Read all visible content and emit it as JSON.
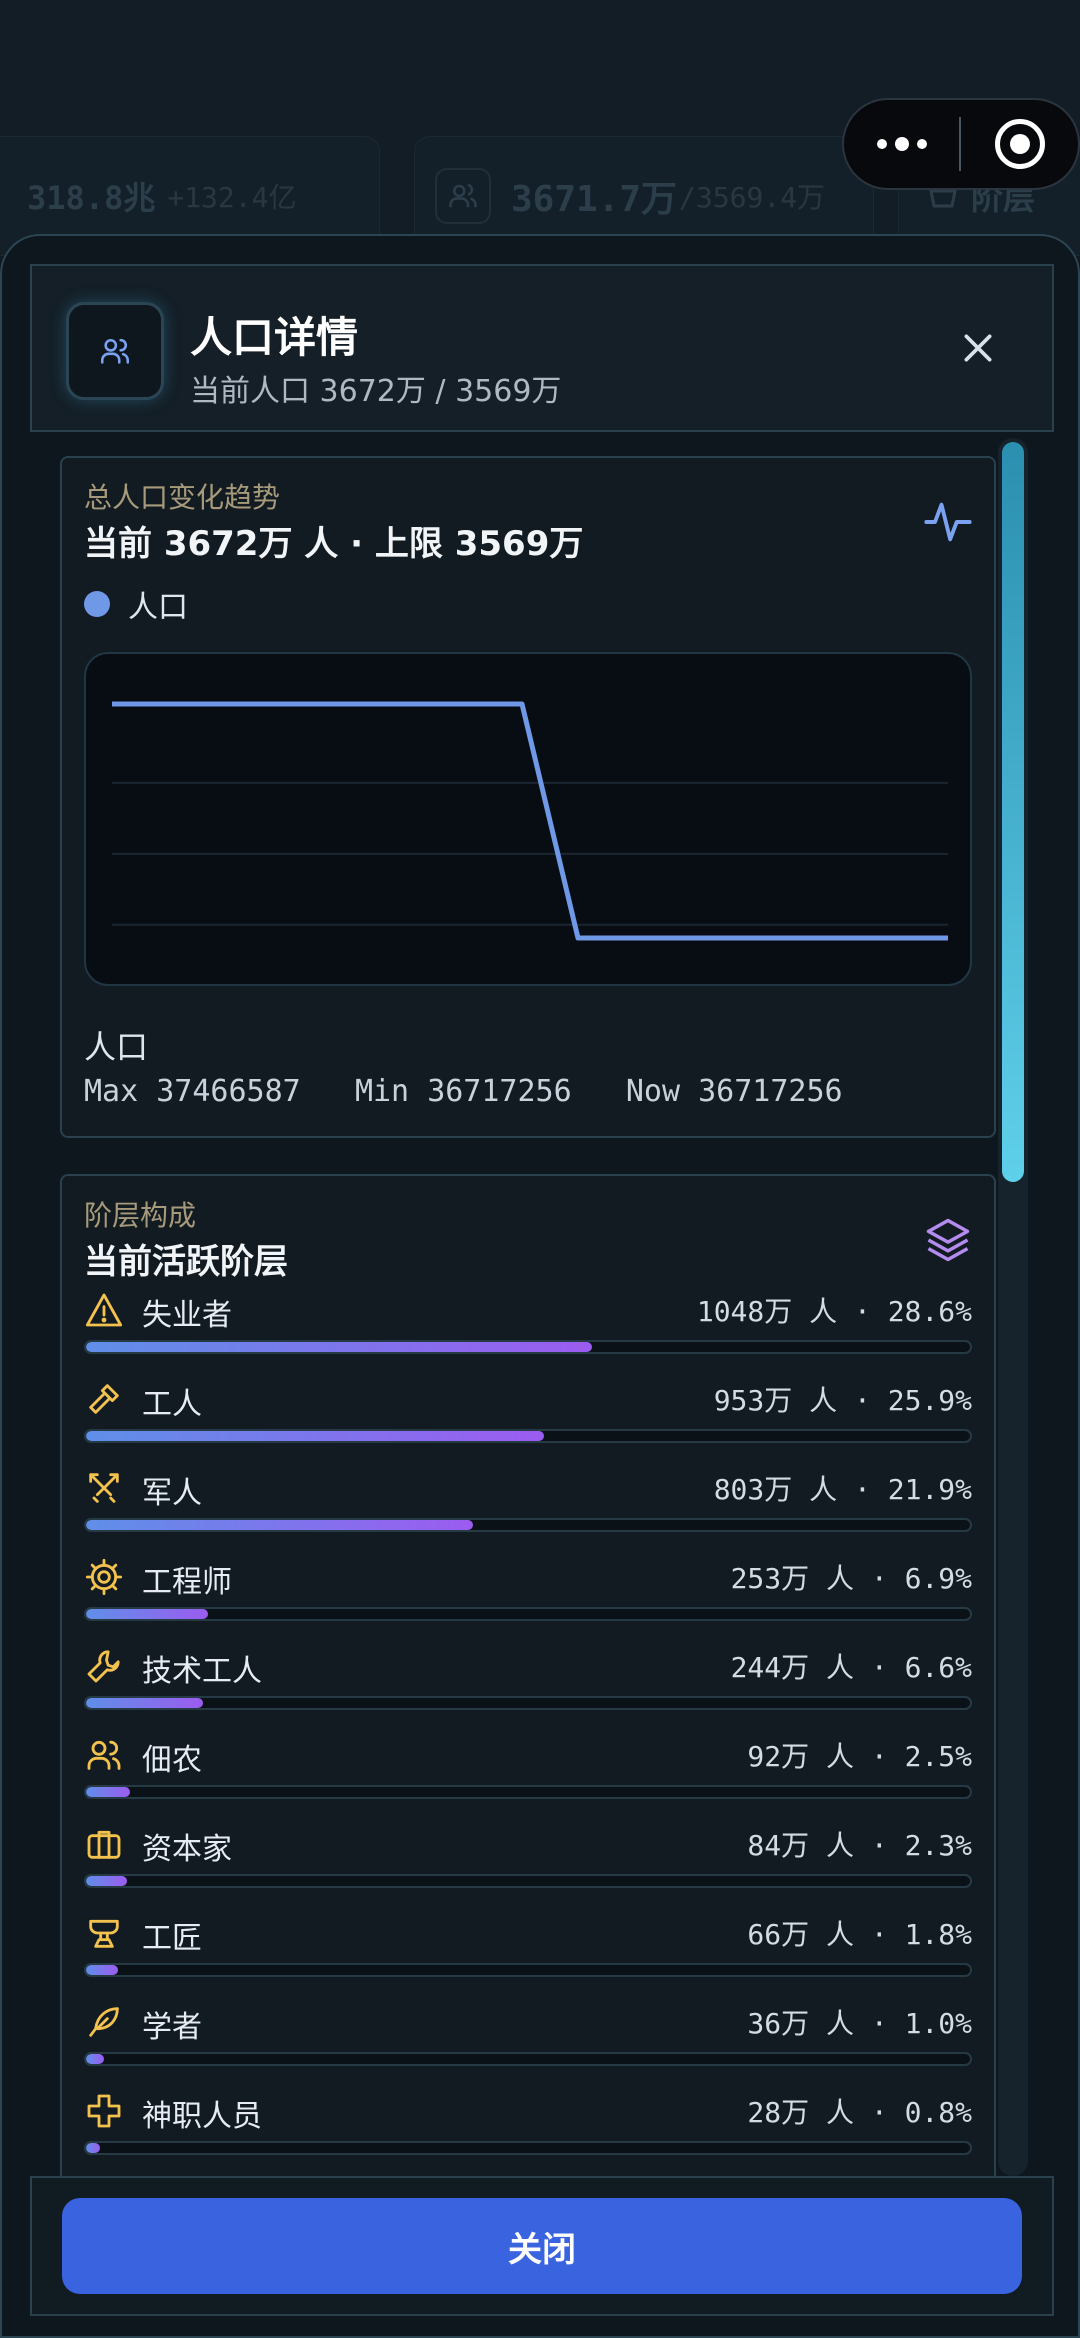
{
  "background": {
    "resource_value": "318.8兆",
    "resource_delta": "+132.4亿",
    "population_value": "3671.7万",
    "population_cap": "/3569.4万",
    "strata_label": "阶层"
  },
  "capsule": {
    "more_icon": "more-dots-icon",
    "close_icon": "target-circle-icon"
  },
  "header": {
    "title": "人口详情",
    "subtitle": "当前人口 3672万 / 3569万",
    "icon": "users-icon",
    "close_icon": "close-icon"
  },
  "trend_card": {
    "label": "总人口变化趋势",
    "title": "当前 3672万 人 · 上限 3569万",
    "legend": "人口",
    "stat_label": "人口",
    "stats": [
      {
        "key": "Max",
        "value": "37466587"
      },
      {
        "key": "Min",
        "value": "36717256"
      },
      {
        "key": "Now",
        "value": "36717256"
      }
    ],
    "icon": "activity-icon"
  },
  "chart_data": {
    "type": "line",
    "x": [
      0,
      1,
      2,
      3
    ],
    "series": [
      {
        "name": "人口",
        "values": [
          37466587,
          37466587,
          36717256,
          36717256
        ]
      }
    ],
    "color": "#6f98e6",
    "grid": true
  },
  "strata_card": {
    "label": "阶层构成",
    "title": "当前活跃阶层",
    "icon": "layers-icon",
    "items": [
      {
        "name": "失业者",
        "value": "1048万 人 · 28.6%",
        "pct": 28.6,
        "icon": "warning-icon"
      },
      {
        "name": "工人",
        "value": "953万 人 · 25.9%",
        "pct": 25.9,
        "icon": "hammer-icon"
      },
      {
        "name": "军人",
        "value": "803万 人 · 21.9%",
        "pct": 21.9,
        "icon": "swords-icon"
      },
      {
        "name": "工程师",
        "value": "253万 人 · 6.9%",
        "pct": 6.9,
        "icon": "cog-icon"
      },
      {
        "name": "技术工人",
        "value": "244万 人 · 6.6%",
        "pct": 6.6,
        "icon": "wrench-icon"
      },
      {
        "name": "佃农",
        "value": "92万 人 · 2.5%",
        "pct": 2.5,
        "icon": "users-icon"
      },
      {
        "name": "资本家",
        "value": "84万 人 · 2.3%",
        "pct": 2.3,
        "icon": "briefcase-icon"
      },
      {
        "name": "工匠",
        "value": "66万 人 · 1.8%",
        "pct": 1.8,
        "icon": "anvil-icon"
      },
      {
        "name": "学者",
        "value": "36万 人 · 1.0%",
        "pct": 1.0,
        "icon": "feather-icon"
      },
      {
        "name": "神职人员",
        "value": "28万 人 · 0.8%",
        "pct": 0.8,
        "icon": "cross-icon"
      }
    ]
  },
  "footer": {
    "close_label": "关闭"
  }
}
